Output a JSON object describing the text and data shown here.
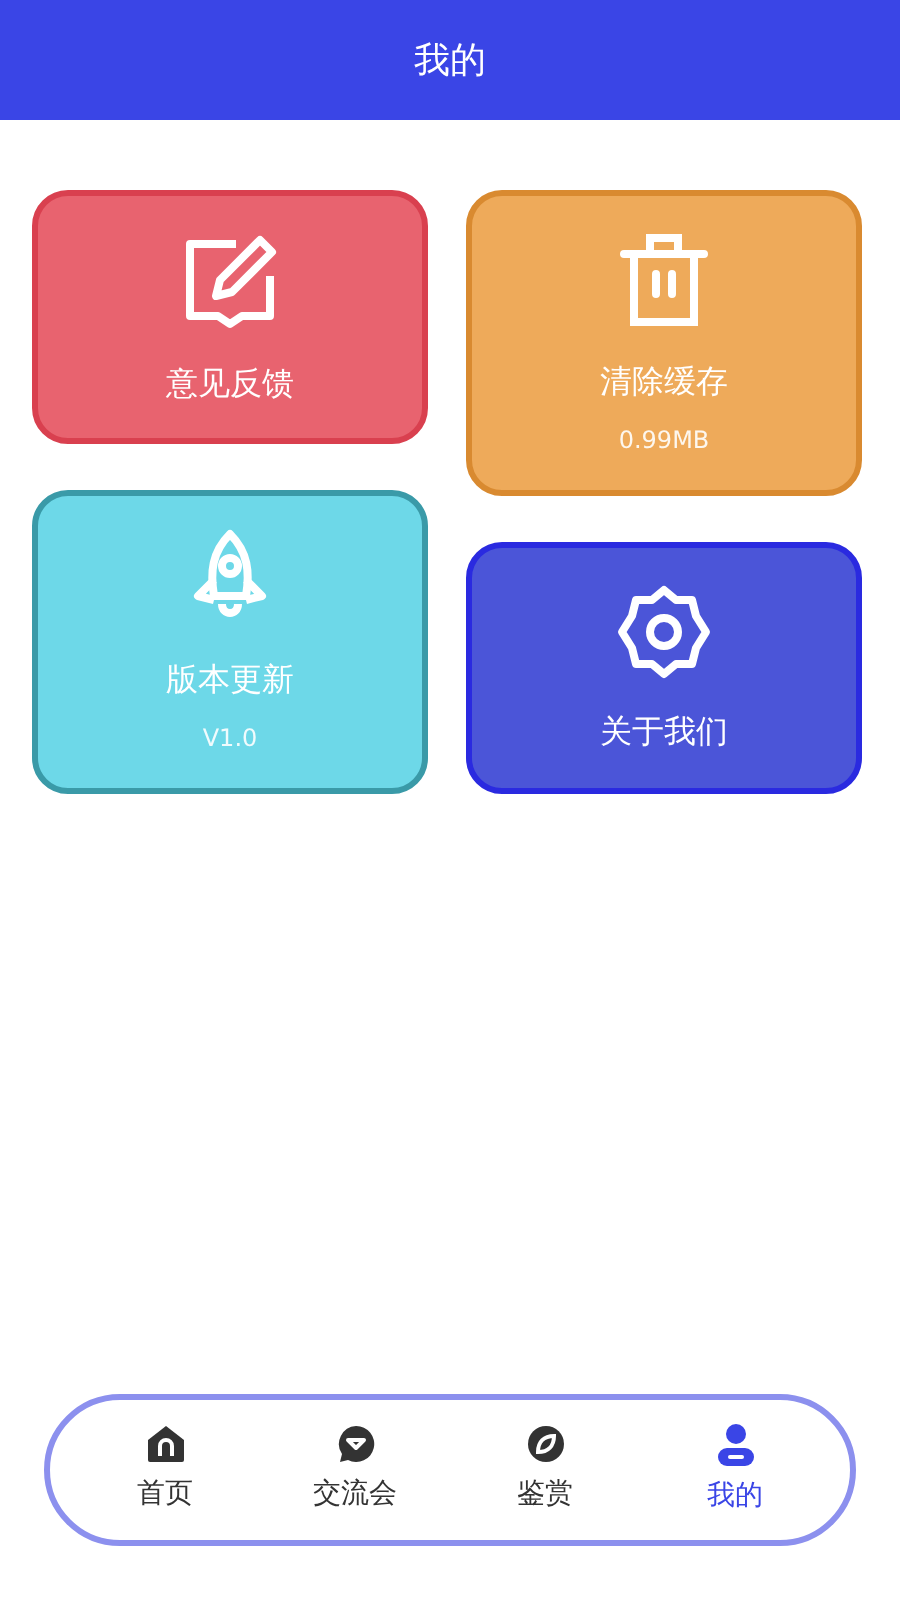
{
  "header": {
    "title": "我的"
  },
  "cards": [
    {
      "kind": "feedback",
      "label": "意见反馈"
    },
    {
      "kind": "clear",
      "label": "清除缓存",
      "sub": "0.99MB"
    },
    {
      "kind": "update",
      "label": "版本更新",
      "sub": "V1.0"
    },
    {
      "kind": "about",
      "label": "关于我们"
    }
  ],
  "nav": [
    {
      "kind": "home",
      "label": "首页",
      "selected": false
    },
    {
      "kind": "chat",
      "label": "交流会",
      "selected": false
    },
    {
      "kind": "compass",
      "label": "鉴赏",
      "selected": false
    },
    {
      "kind": "user",
      "label": "我的",
      "selected": true
    }
  ]
}
